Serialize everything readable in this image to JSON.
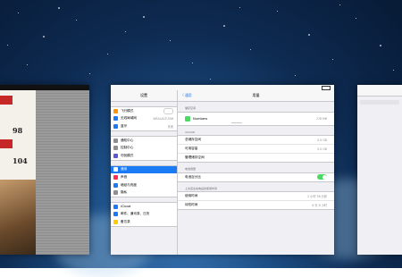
{
  "settings": {
    "sidebar_title": "设置",
    "groups": [
      [
        {
          "label": "飞行模式",
          "icon": "airplane-icon",
          "color": "#ff9500",
          "value": ""
        },
        {
          "label": "无线局域网",
          "icon": "wifi-icon",
          "color": "#1a7bf5",
          "value": "WEALACE-TAN"
        },
        {
          "label": "蓝牙",
          "icon": "bluetooth-icon",
          "color": "#1a7bf5",
          "value": "关闭"
        }
      ],
      [
        {
          "label": "通知中心",
          "icon": "notification-icon",
          "color": "#8e8e93",
          "value": ""
        },
        {
          "label": "控制中心",
          "icon": "control-center-icon",
          "color": "#8e8e93",
          "value": ""
        },
        {
          "label": "勿扰模式",
          "icon": "moon-icon",
          "color": "#5856d6",
          "value": ""
        }
      ],
      [
        {
          "label": "通用",
          "icon": "gear-icon",
          "color": "#8e8e93",
          "value": "",
          "selected": true
        },
        {
          "label": "声音",
          "icon": "sound-icon",
          "color": "#ff2d55",
          "value": ""
        },
        {
          "label": "墙纸与亮度",
          "icon": "wallpaper-icon",
          "color": "#1a7bf5",
          "value": ""
        },
        {
          "label": "隐私",
          "icon": "hand-icon",
          "color": "#8e8e93",
          "value": ""
        }
      ],
      [
        {
          "label": "iCloud",
          "icon": "cloud-icon",
          "color": "#1a7bf5",
          "value": ""
        },
        {
          "label": "邮件、通讯录、日历",
          "icon": "mail-icon",
          "color": "#1a7bf5",
          "value": ""
        },
        {
          "label": "备忘录",
          "icon": "notes-icon",
          "color": "#ffcc00",
          "value": ""
        }
      ]
    ]
  },
  "detail": {
    "back_label": "〈 通用",
    "title": "用量",
    "section1": "储存空间",
    "app_name": "Numbers",
    "app_size": "276 MB",
    "section2": "iCLOUD",
    "storage_rows": [
      {
        "label": "总储存空间",
        "value": "5.0 GB"
      },
      {
        "label": "可用容量",
        "value": "5.0 GB"
      },
      {
        "label": "管理储存空间",
        "value": ""
      }
    ],
    "section3": "电池用量",
    "battery_label": "电池百分比",
    "section4": "上次完全充电后的使用时间",
    "usage_rows": [
      {
        "label": "使用时间",
        "value": "2 小时 36 分钟"
      },
      {
        "label": "待机时间",
        "value": "6 天 8 小时"
      }
    ],
    "colors": {
      "accent": "#1a7bf5",
      "toggle_on": "#4cd964"
    }
  },
  "magazine": {
    "numbers": [
      "98",
      "104"
    ]
  }
}
